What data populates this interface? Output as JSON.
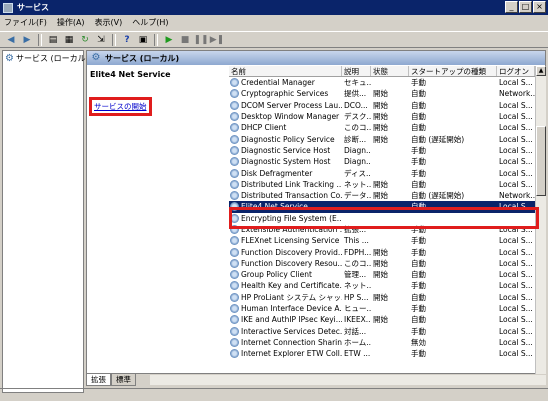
{
  "window": {
    "title": "サービス"
  },
  "menu": [
    "ファイル(F)",
    "操作(A)",
    "表示(V)",
    "ヘルプ(H)"
  ],
  "tree": {
    "label": "サービス (ローカル)"
  },
  "pane": {
    "header": "サービス (ローカル)",
    "selected_service": "Elite4 Net Service",
    "start_link": "サービスの開始"
  },
  "columns": [
    "名前",
    "説明",
    "状態",
    "スタートアップの種類",
    "ログオン"
  ],
  "services": [
    {
      "name": "Credential Manager",
      "desc": "セキュ...",
      "status": "",
      "startup": "手動",
      "logon": "Local S..."
    },
    {
      "name": "Cryptographic Services",
      "desc": "提供...",
      "status": "開始",
      "startup": "自動",
      "logon": "Network..."
    },
    {
      "name": "DCOM Server Process Lau...",
      "desc": "DCO...",
      "status": "開始",
      "startup": "自動",
      "logon": "Local S..."
    },
    {
      "name": "Desktop Window Manager ...",
      "desc": "デスク...",
      "status": "開始",
      "startup": "自動",
      "logon": "Local S..."
    },
    {
      "name": "DHCP Client",
      "desc": "このコ...",
      "status": "開始",
      "startup": "自動",
      "logon": "Local S..."
    },
    {
      "name": "Diagnostic Policy Service",
      "desc": "診断...",
      "status": "開始",
      "startup": "自動 (遅延開始)",
      "logon": "Local S..."
    },
    {
      "name": "Diagnostic Service Host",
      "desc": "Diagn...",
      "status": "",
      "startup": "手動",
      "logon": "Local S..."
    },
    {
      "name": "Diagnostic System Host",
      "desc": "Diagn...",
      "status": "",
      "startup": "手動",
      "logon": "Local S..."
    },
    {
      "name": "Disk Defragmenter",
      "desc": "ディス...",
      "status": "",
      "startup": "手動",
      "logon": "Local S..."
    },
    {
      "name": "Distributed Link Tracking ...",
      "desc": "ネット...",
      "status": "開始",
      "startup": "自動",
      "logon": "Local S..."
    },
    {
      "name": "Distributed Transaction Co...",
      "desc": "データ...",
      "status": "開始",
      "startup": "自動 (遅延開始)",
      "logon": "Network..."
    },
    {
      "name": "Elite4 Net Service",
      "desc": "",
      "status": "",
      "startup": "自動",
      "logon": "Local S..."
    },
    {
      "name": "Encrypting File System (E...",
      "desc": "",
      "status": "",
      "startup": "",
      "logon": ""
    },
    {
      "name": "Extensible Authentication ...",
      "desc": "拡張...",
      "status": "",
      "startup": "手動",
      "logon": "Local S..."
    },
    {
      "name": "FLEXnet Licensing Service",
      "desc": "This ...",
      "status": "",
      "startup": "手動",
      "logon": "Local S..."
    },
    {
      "name": "Function Discovery Provid...",
      "desc": "FDPH...",
      "status": "開始",
      "startup": "手動",
      "logon": "Local S..."
    },
    {
      "name": "Function Discovery Resou...",
      "desc": "このコ...",
      "status": "開始",
      "startup": "自動",
      "logon": "Local S..."
    },
    {
      "name": "Group Policy Client",
      "desc": "管理...",
      "status": "開始",
      "startup": "自動",
      "logon": "Local S..."
    },
    {
      "name": "Health Key and Certificate...",
      "desc": "ネット...",
      "status": "",
      "startup": "手動",
      "logon": "Local S..."
    },
    {
      "name": "HP ProLiant システム シャッ...",
      "desc": "HP S...",
      "status": "開始",
      "startup": "自動",
      "logon": "Local S..."
    },
    {
      "name": "Human Interface Device A...",
      "desc": "ヒュー...",
      "status": "",
      "startup": "手動",
      "logon": "Local S..."
    },
    {
      "name": "IKE and AuthIP IPsec Keyi...",
      "desc": "IKEEX...",
      "status": "開始",
      "startup": "自動",
      "logon": "Local S..."
    },
    {
      "name": "Interactive Services Detec...",
      "desc": "対話...",
      "status": "",
      "startup": "手動",
      "logon": "Local S..."
    },
    {
      "name": "Internet Connection Sharin...",
      "desc": "ホーム...",
      "status": "",
      "startup": "無効",
      "logon": "Local S..."
    },
    {
      "name": "Internet Explorer ETW Coll...",
      "desc": "ETW ...",
      "status": "",
      "startup": "手動",
      "logon": "Local S..."
    }
  ],
  "tabs": [
    "拡張",
    "標準"
  ]
}
